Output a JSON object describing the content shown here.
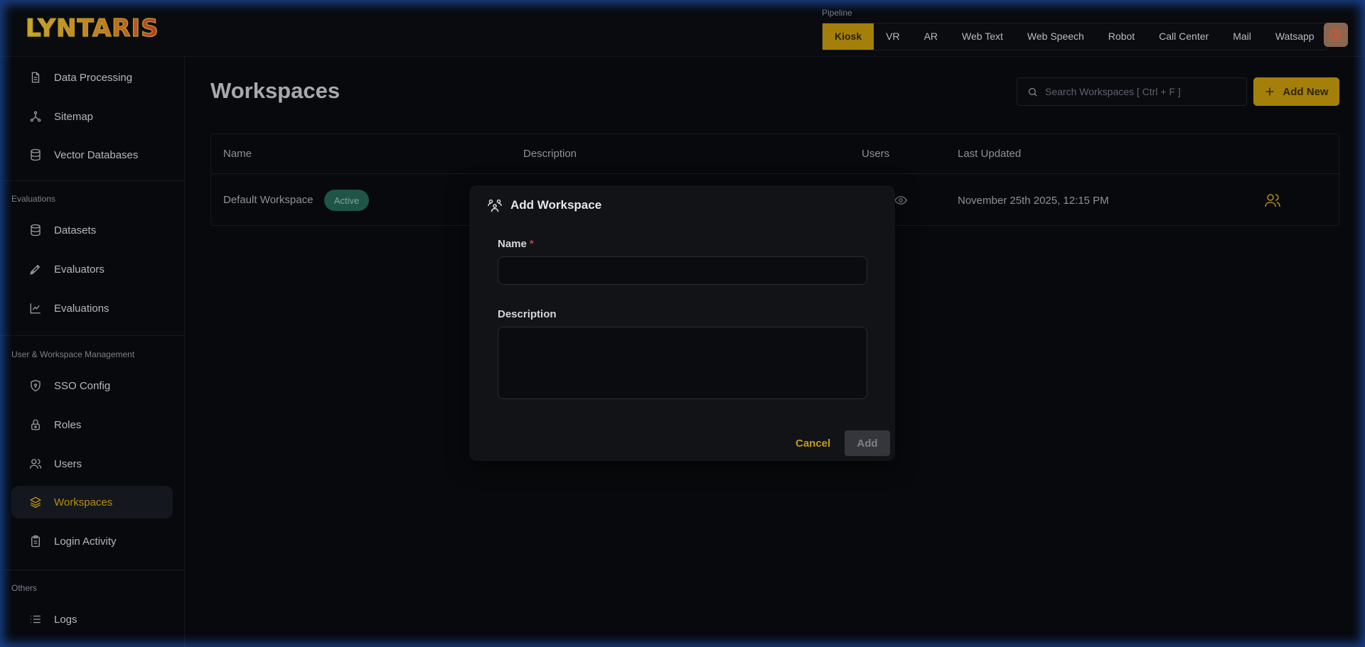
{
  "app": {
    "logo_text": "LYNTARIS"
  },
  "header": {
    "pipeline_label": "Pipeline",
    "tabs": [
      {
        "label": "Kiosk",
        "active": true
      },
      {
        "label": "VR"
      },
      {
        "label": "AR"
      },
      {
        "label": "Web Text"
      },
      {
        "label": "Web Speech"
      },
      {
        "label": "Robot"
      },
      {
        "label": "Call Center"
      },
      {
        "label": "Mail"
      },
      {
        "label": "Watsapp"
      }
    ],
    "settings_icon": "gear-icon"
  },
  "sidebar": {
    "items_top": [
      {
        "label": "Data Processing",
        "icon": "document-icon"
      },
      {
        "label": "Sitemap",
        "icon": "network-icon"
      },
      {
        "label": "Vector Databases",
        "icon": "database-icon"
      }
    ],
    "sections": [
      {
        "label": "Evaluations",
        "items": [
          {
            "label": "Datasets",
            "icon": "database-icon"
          },
          {
            "label": "Evaluators",
            "icon": "pen-tool-icon"
          },
          {
            "label": "Evaluations",
            "icon": "chart-icon"
          }
        ]
      },
      {
        "label": "User & Workspace Management",
        "items": [
          {
            "label": "SSO Config",
            "icon": "shield-icon"
          },
          {
            "label": "Roles",
            "icon": "lock-icon"
          },
          {
            "label": "Users",
            "icon": "users-icon"
          },
          {
            "label": "Workspaces",
            "icon": "layers-icon",
            "active": true
          },
          {
            "label": "Login Activity",
            "icon": "clipboard-icon"
          }
        ]
      },
      {
        "label": "Others",
        "items": [
          {
            "label": "Logs",
            "icon": "list-icon"
          }
        ]
      }
    ]
  },
  "main": {
    "title": "Workspaces",
    "search_placeholder": "Search Workspaces [ Ctrl + F ]",
    "add_new_label": "Add New",
    "table": {
      "columns": [
        "Name",
        "Description",
        "Users",
        "Last Updated"
      ],
      "rows": [
        {
          "name": "Default Workspace",
          "status": "Active",
          "description": "",
          "last_updated": "November 25th 2025, 12:15 PM"
        }
      ]
    }
  },
  "modal": {
    "title": "Add Workspace",
    "name_label": "Name",
    "required_mark": "*",
    "name_value": "",
    "description_label": "Description",
    "description_value": "",
    "cancel_label": "Cancel",
    "add_label": "Add"
  },
  "colors": {
    "accent": "#a4800b",
    "active_badge": "#1f5546",
    "background": "#07090c"
  }
}
